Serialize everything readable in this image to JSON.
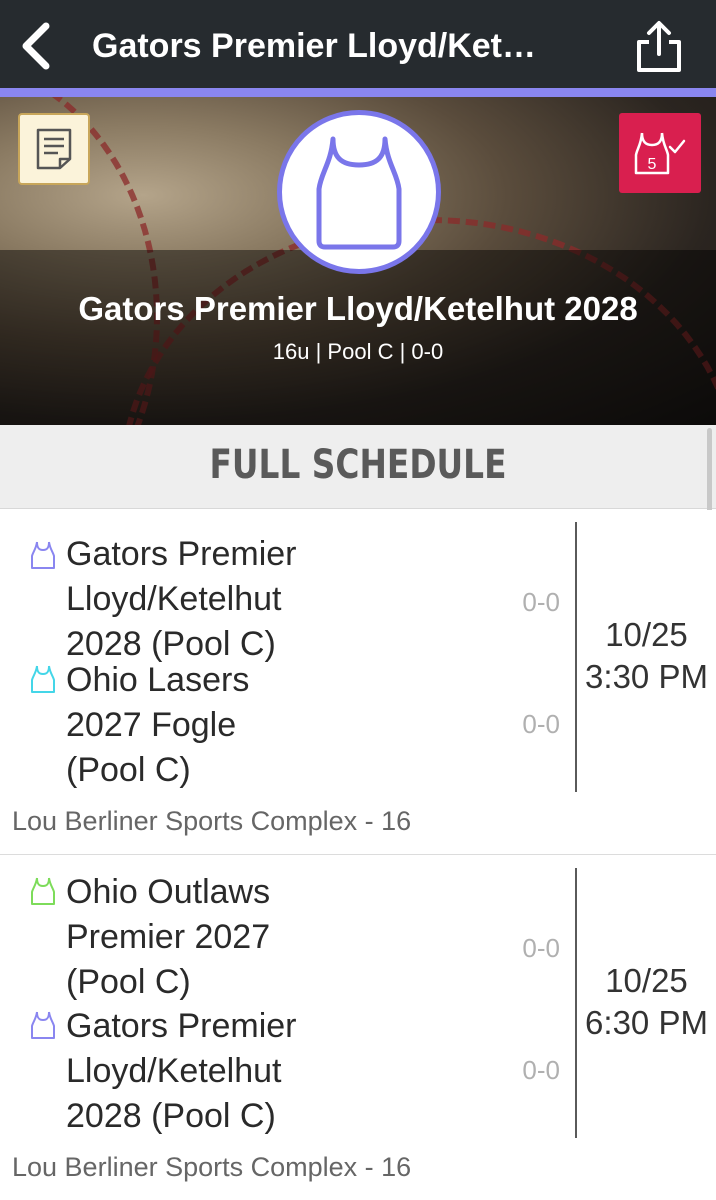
{
  "nav": {
    "title": "Gators Premier Lloyd/Ket…"
  },
  "team": {
    "name": "Gators Premier Lloyd/Ketelhut 2028",
    "meta": "16u | Pool C | 0-0",
    "roster_badge": "5"
  },
  "section": {
    "title": "FULL SCHEDULE"
  },
  "colors": {
    "accent": "#8a86f0",
    "nav_bg": "#262b2f",
    "roster_badge_bg": "#d91f4f",
    "jersey_gators": "#8a86f0",
    "jersey_lasers": "#44d6e8",
    "jersey_outlaws": "#7ddc5a"
  },
  "games": [
    {
      "teams": [
        {
          "name": "Gators Premier Lloyd/Ketelhut 2028 (Pool C)",
          "lines": [
            "Gators Premier",
            "Lloyd/Ketelhut",
            "2028 (Pool C)"
          ],
          "record": "0-0",
          "icon": "jersey-icon-purple"
        },
        {
          "name": "Ohio Lasers 2027 Fogle (Pool C)",
          "lines": [
            "Ohio Lasers",
            "2027 Fogle",
            "(Pool C)"
          ],
          "record": "0-0",
          "icon": "jersey-icon-cyan"
        }
      ],
      "date": "10/25",
      "time": "3:30 PM",
      "venue": "Lou Berliner Sports Complex - 16"
    },
    {
      "teams": [
        {
          "name": "Ohio Outlaws Premier 2027 (Pool C)",
          "lines": [
            "Ohio Outlaws",
            "Premier 2027",
            "(Pool C)"
          ],
          "record": "0-0",
          "icon": "jersey-icon-green"
        },
        {
          "name": "Gators Premier Lloyd/Ketelhut 2028 (Pool C)",
          "lines": [
            "Gators Premier",
            "Lloyd/Ketelhut",
            "2028 (Pool C)"
          ],
          "record": "0-0",
          "icon": "jersey-icon-purple"
        }
      ],
      "date": "10/25",
      "time": "6:30 PM",
      "venue": "Lou Berliner Sports Complex - 16"
    }
  ]
}
